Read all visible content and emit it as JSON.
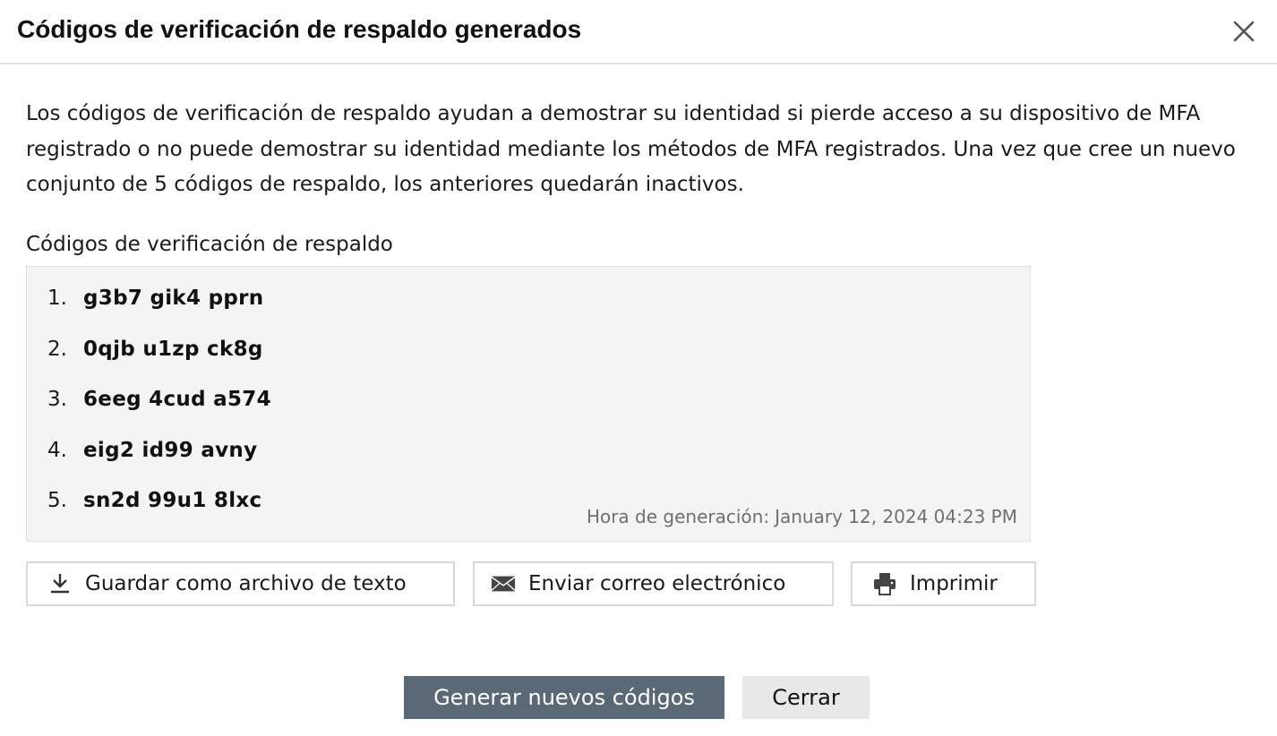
{
  "dialog": {
    "title": "Códigos de verificación de respaldo generados",
    "close_icon": "close-icon",
    "description": "Los códigos de verificación de respaldo ayudan a demostrar su identidad si pierde acceso a su dispositivo de MFA registrado o no puede demostrar su identidad mediante los métodos de MFA registrados. Una vez que cree un nuevo conjunto de 5 códigos de respaldo, los anteriores quedarán inactivos.",
    "codes_label": "Códigos de verificación de respaldo",
    "codes": [
      {
        "number": "1.",
        "value": "g3b7 gik4 pprn"
      },
      {
        "number": "2.",
        "value": "0qjb u1zp ck8g"
      },
      {
        "number": "3.",
        "value": "6eeg 4cud a574"
      },
      {
        "number": "4.",
        "value": "eig2 id99 avny"
      },
      {
        "number": "5.",
        "value": "sn2d 99u1 8lxc"
      }
    ],
    "generation_time_label": "Hora de generación:",
    "generation_time": "January 12, 2024 04:23 PM"
  },
  "actions": {
    "save_label": "Guardar como archivo de texto",
    "save_icon": "download-icon",
    "email_label": "Enviar correo electrónico",
    "email_icon": "envelope-icon",
    "print_label": "Imprimir",
    "print_icon": "printer-icon"
  },
  "footer": {
    "generate_label": "Generar nuevos códigos",
    "close_label": "Cerrar"
  },
  "colors": {
    "primary_button": "#5b6876",
    "secondary_button": "#e8e8e8",
    "codes_background": "#f4f4f4",
    "muted_text": "#6f6f6f"
  }
}
